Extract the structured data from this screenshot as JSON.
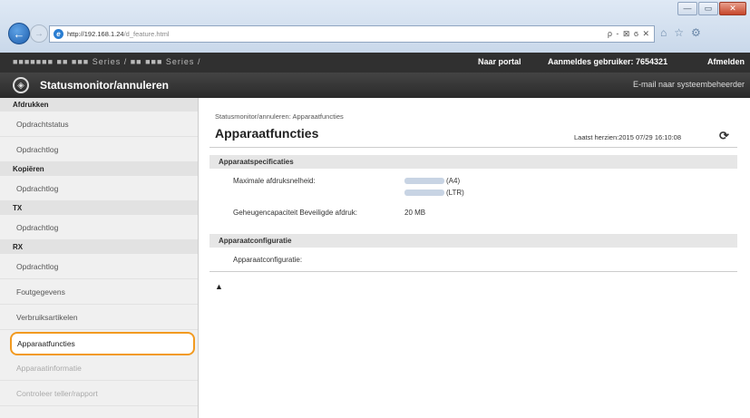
{
  "browser": {
    "url_host": "http://192.168.1.24",
    "url_path": "/d_feature.html",
    "addr_controls": "ρ - ⊠ ϭ ✕",
    "window_controls": [
      "—",
      "▭",
      "✕"
    ]
  },
  "header": {
    "model_text": "■■■■■■■   ■■ ■■■ Series / ■■ ■■■ Series /",
    "portal_link": "Naar portal",
    "user_label": "Aanmeldes gebruiker: 7654321",
    "logout_link": "Afmelden",
    "app_title": "Statusmonitor/annuleren",
    "mail_link": "E-mail naar systeembeheerder"
  },
  "sidebar": {
    "groups": [
      {
        "title": "Afdrukken",
        "items": [
          "Opdrachtstatus",
          "Opdrachtlog"
        ]
      },
      {
        "title": "Kopiëren",
        "items": [
          "Opdrachtlog"
        ]
      },
      {
        "title": "TX",
        "items": [
          "Opdrachtlog"
        ]
      },
      {
        "title": "RX",
        "items": [
          "Opdrachtlog"
        ]
      }
    ],
    "extra_items": [
      "Foutgegevens",
      "Verbruiksartikelen",
      "Apparaatfuncties",
      "Apparaatinformatie",
      "Controleer teller/rapport"
    ],
    "selected": "Apparaatfuncties"
  },
  "main": {
    "breadcrumb": "Statusmonitor/annuleren: Apparaatfuncties",
    "title": "Apparaatfuncties",
    "last_updated": "Laatst herzien:2015 07/29 16:10:08",
    "sections": [
      {
        "title": "Apparaatspecificaties",
        "rows": [
          {
            "label": "Maximale afdruksnelheid:",
            "values": [
              "(A4)",
              "(LTR)"
            ]
          },
          {
            "label": "Geheugencapaciteit Beveiligde afdruk:",
            "values": [
              "20 MB"
            ]
          }
        ]
      },
      {
        "title": "Apparaatconfiguratie",
        "rows": [
          {
            "label": "Apparaatconfiguratie:",
            "values": []
          }
        ]
      }
    ],
    "top_link": "▲"
  },
  "colors": {
    "highlight": "#f29a20",
    "header_dark": "#303030"
  }
}
